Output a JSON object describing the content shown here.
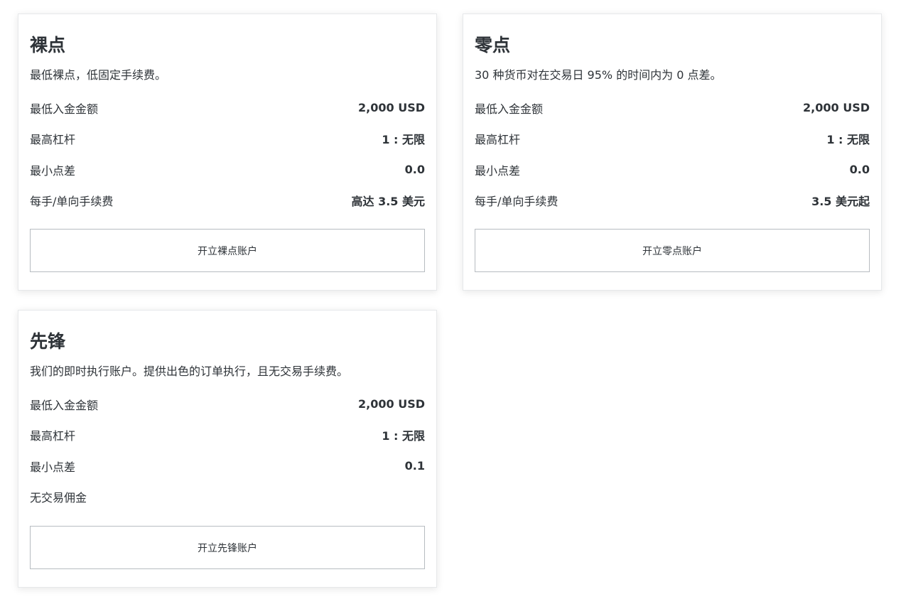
{
  "cards": [
    {
      "title": "裸点",
      "description": "最低裸点，低固定手续费。",
      "rows": [
        {
          "label": "最低入金金额",
          "value": "2,000 USD"
        },
        {
          "label": "最高杠杆",
          "value": "1 : 无限"
        },
        {
          "label": "最小点差",
          "value": "0.0"
        },
        {
          "label": "每手/单向手续费",
          "value": "高达 3.5 美元"
        }
      ],
      "button_label": "开立裸点账户"
    },
    {
      "title": "零点",
      "description": "30 种货币对在交易日 95% 的时间内为 0 点差。",
      "rows": [
        {
          "label": "最低入金金额",
          "value": "2,000 USD"
        },
        {
          "label": "最高杠杆",
          "value": "1 : 无限"
        },
        {
          "label": "最小点差",
          "value": "0.0"
        },
        {
          "label": "每手/单向手续费",
          "value": "3.5 美元起"
        }
      ],
      "button_label": "开立零点账户"
    },
    {
      "title": "先锋",
      "description": "我们的即时执行账户。提供出色的订单执行，且无交易手续费。",
      "rows": [
        {
          "label": "最低入金金额",
          "value": "2,000 USD"
        },
        {
          "label": "最高杠杆",
          "value": "1 : 无限"
        },
        {
          "label": "最小点差",
          "value": "0.1"
        },
        {
          "label": "无交易佣金",
          "value": ""
        }
      ],
      "button_label": "开立先锋账户"
    }
  ],
  "colors": {
    "text": "#2e3338",
    "card_border": "#e6e8ea",
    "button_border": "#b7bcc1",
    "background": "#ffffff"
  }
}
